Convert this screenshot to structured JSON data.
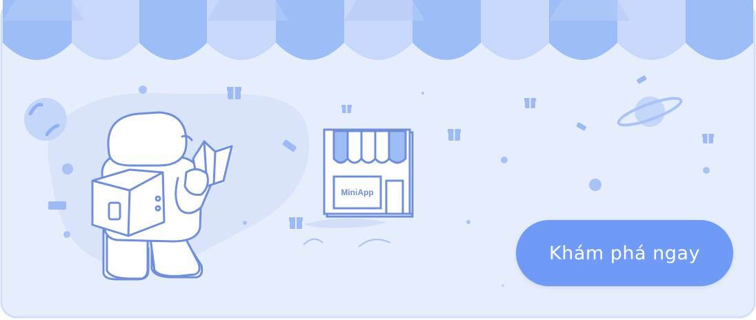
{
  "banner": {
    "store_sign": "MiniApp",
    "cta_label": "Khám phá ngay"
  },
  "colors": {
    "background": "#e6edfc",
    "awning_dark": "#9dbdf8",
    "awning_light": "#c8d8fb",
    "accent": "#6f9bf7",
    "line": "#6f8fd8"
  },
  "icons": [
    "astronaut-illustration",
    "shop-illustration",
    "gift-icon",
    "planet-icon",
    "moon-icon",
    "ticket-icon"
  ]
}
